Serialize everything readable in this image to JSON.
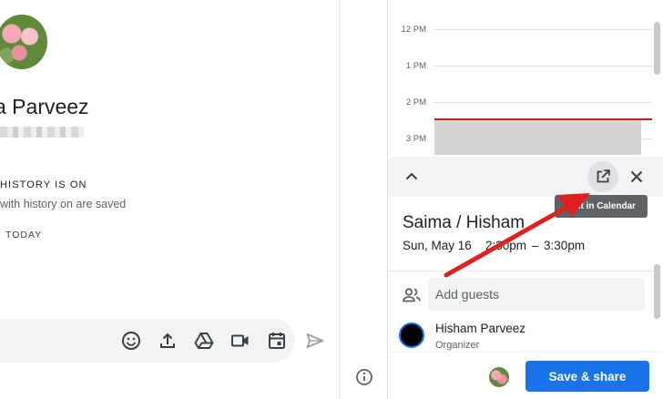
{
  "chat": {
    "contact_name": "a Parveez",
    "history_status": "HISTORY IS ON",
    "history_note": "with history on are saved",
    "date_divider": "TODAY"
  },
  "composer": {
    "icons": [
      "emoji-icon",
      "upload-icon",
      "drive-icon",
      "video-icon",
      "calendar-icon"
    ],
    "send_icon": "send-icon"
  },
  "info_icon": "info-icon",
  "calendar": {
    "hours": [
      "12 PM",
      "1 PM",
      "2 PM",
      "3 PM"
    ],
    "current_time_color": "#c5221f"
  },
  "event_detail": {
    "tooltip": "Edit in Calendar",
    "title": "Saima / Hisham",
    "date": "Sun, May 16",
    "time": "2:30pm  –  3:30pm",
    "guests_placeholder": "Add guests",
    "organizer_name": "Hisham Parveez",
    "organizer_role": "Organizer",
    "save_label": "Save & share"
  },
  "colors": {
    "accent": "#1a73e8",
    "annotation_arrow": "#e02020"
  }
}
